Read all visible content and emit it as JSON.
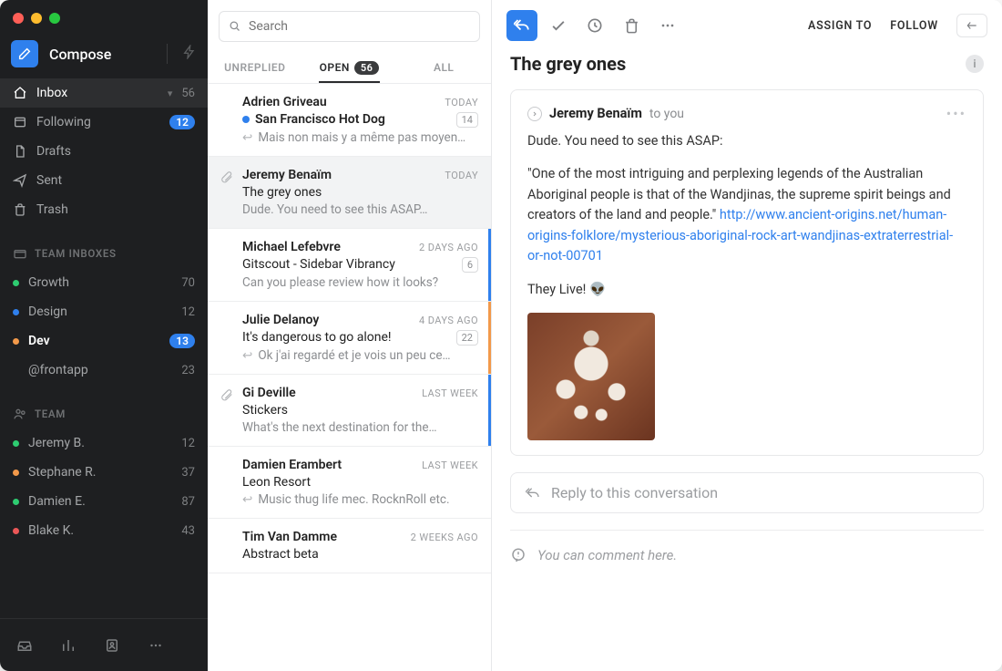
{
  "sidebar": {
    "compose_label": "Compose",
    "main_nav": [
      {
        "icon": "home",
        "label": "Inbox",
        "count": "56",
        "has_chevron": true,
        "active": true,
        "badge": false
      },
      {
        "icon": "following",
        "label": "Following",
        "count": "12",
        "has_chevron": false,
        "active": false,
        "badge": true
      },
      {
        "icon": "drafts",
        "label": "Drafts",
        "count": "",
        "has_chevron": false,
        "active": false,
        "badge": false
      },
      {
        "icon": "sent",
        "label": "Sent",
        "count": "",
        "has_chevron": false,
        "active": false,
        "badge": false
      },
      {
        "icon": "trash",
        "label": "Trash",
        "count": "",
        "has_chevron": false,
        "active": false,
        "badge": false
      }
    ],
    "team_inboxes_header": "TEAM INBOXES",
    "team_inboxes": [
      {
        "color": "#2ecc71",
        "label": "Growth",
        "count": "70",
        "badge": false,
        "bold": false
      },
      {
        "color": "#2f80ed",
        "label": "Design",
        "count": "12",
        "badge": false,
        "bold": false
      },
      {
        "color": "#f2994a",
        "label": "Dev",
        "count": "13",
        "badge": true,
        "bold": true
      },
      {
        "color": "",
        "label": "@frontapp",
        "count": "23",
        "badge": false,
        "bold": false
      }
    ],
    "team_header": "TEAM",
    "team": [
      {
        "color": "#2ecc71",
        "label": "Jeremy B.",
        "count": "12"
      },
      {
        "color": "#f2994a",
        "label": "Stephane R.",
        "count": "37"
      },
      {
        "color": "#2ecc71",
        "label": "Damien E.",
        "count": "87"
      },
      {
        "color": "#eb5757",
        "label": "Blake K.",
        "count": "43"
      }
    ]
  },
  "search": {
    "placeholder": "Search"
  },
  "tabs": {
    "unreplied": "UNREPLIED",
    "open": "OPEN",
    "open_count": "56",
    "all": "ALL"
  },
  "threads": [
    {
      "left_icon": "",
      "sender": "Adrien Griveau",
      "time": "TODAY",
      "subject_prefix_dot": true,
      "subject": "San Francisco Hot Dog",
      "subject_bold": true,
      "badge": "14",
      "preview_reply": true,
      "preview": "Mais non mais y a même pas moyen…",
      "accent": "",
      "selected": false
    },
    {
      "left_icon": "attach",
      "sender": "Jeremy Benaïm",
      "time": "TODAY",
      "subject_prefix_dot": false,
      "subject": "The grey ones",
      "subject_bold": false,
      "badge": "",
      "preview_reply": false,
      "preview": "Dude. You need to see this ASAP…",
      "accent": "",
      "selected": true
    },
    {
      "left_icon": "",
      "sender": "Michael Lefebvre",
      "time": "2 DAYS AGO",
      "subject_prefix_dot": false,
      "subject": "Gitscout - Sidebar Vibrancy",
      "subject_bold": false,
      "badge": "6",
      "preview_reply": false,
      "preview": "Can you please review how it looks?",
      "accent": "#2f80ed",
      "selected": false
    },
    {
      "left_icon": "",
      "sender": "Julie Delanoy",
      "time": "4 DAYS AGO",
      "subject_prefix_dot": false,
      "subject": "It's dangerous to go alone!",
      "subject_bold": false,
      "badge": "22",
      "preview_reply": true,
      "preview": "Ok j'ai regardé et je vois un peu ce…",
      "accent": "#f2994a",
      "selected": false
    },
    {
      "left_icon": "attach",
      "sender": "Gi Deville",
      "time": "LAST WEEK",
      "subject_prefix_dot": false,
      "subject": "Stickers",
      "subject_bold": false,
      "badge": "",
      "preview_reply": false,
      "preview": "What's the next destination for the…",
      "accent": "#2f80ed",
      "selected": false
    },
    {
      "left_icon": "",
      "sender": "Damien Erambert",
      "time": "LAST WEEK",
      "subject_prefix_dot": false,
      "subject": "Leon Resort",
      "subject_bold": false,
      "badge": "",
      "preview_reply": true,
      "preview": "Music thug life mec. RocknRoll etc.",
      "accent": "",
      "selected": false
    },
    {
      "left_icon": "",
      "sender": "Tim Van Damme",
      "time": "2 WEEKS AGO",
      "subject_prefix_dot": false,
      "subject": "Abstract beta",
      "subject_bold": false,
      "badge": "",
      "preview_reply": false,
      "preview": "",
      "accent": "",
      "selected": false
    }
  ],
  "detail": {
    "assign": "ASSIGN TO",
    "follow": "FOLLOW",
    "subject": "The grey ones",
    "from": "Jeremy Benaïm",
    "to": "to you",
    "p1": "Dude. You need to see this ASAP:",
    "p2a": "\"One of the most intriguing and perplexing legends of the Australian Aboriginal people is that of the Wandjinas, the supreme spirit beings and creators of the land and people.\" ",
    "link": "http://www.ancient-origins.net/human-origins-folklore/mysterious-aboriginal-rock-art-wandjinas-extraterrestrial-or-not-00701",
    "p3": "They Live! 👽",
    "reply_placeholder": "Reply to this conversation",
    "comment_placeholder": "You can comment here."
  }
}
